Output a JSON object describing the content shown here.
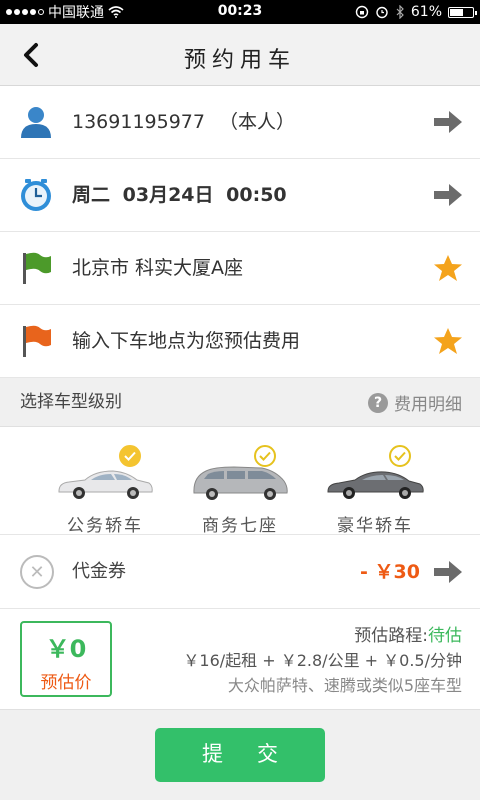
{
  "status_bar": {
    "carrier": "中国联通",
    "time": "00:23",
    "battery": "61%",
    "battery_level": 0.61,
    "signal_bars_filled": 4,
    "signal_bars_total": 5
  },
  "nav": {
    "title": "预约用车"
  },
  "passenger": {
    "phone": "13691195977",
    "tag": "（本人）",
    "icon": "person-icon"
  },
  "time_row": {
    "weekday": "周二",
    "date": "03月24日",
    "time": "00:50",
    "icon": "clock-icon"
  },
  "pickup": {
    "location": "北京市 科实大厦A座",
    "icon": "green-flag-icon"
  },
  "dropoff": {
    "placeholder": "输入下车地点为您预估费用",
    "icon": "orange-flag-icon"
  },
  "car_section": {
    "title": "选择车型级别",
    "fee_detail_label": "费用明细",
    "cars": [
      {
        "label": "公务轿车",
        "selected": true,
        "color": "#e8e8ea"
      },
      {
        "label": "商务七座",
        "selected": false,
        "color": "#b5b7ba"
      },
      {
        "label": "豪华轿车",
        "selected": false,
        "color": "#6c6e72"
      }
    ]
  },
  "coupon": {
    "label": "代金券",
    "amount": "- ￥30"
  },
  "estimate": {
    "price": "￥0",
    "price_label": "预估价",
    "route_label": "预估路程:",
    "route_status": "待估",
    "rates": "￥16/起租 + ￥2.8/公里 + ￥0.5/分钟",
    "models": "大众帕萨特、速腾或类似5座车型"
  },
  "submit": {
    "label": "提交"
  },
  "colors": {
    "accent_green": "#33c06a",
    "accent_orange": "#ee5a14",
    "star": "#f4a31c"
  }
}
